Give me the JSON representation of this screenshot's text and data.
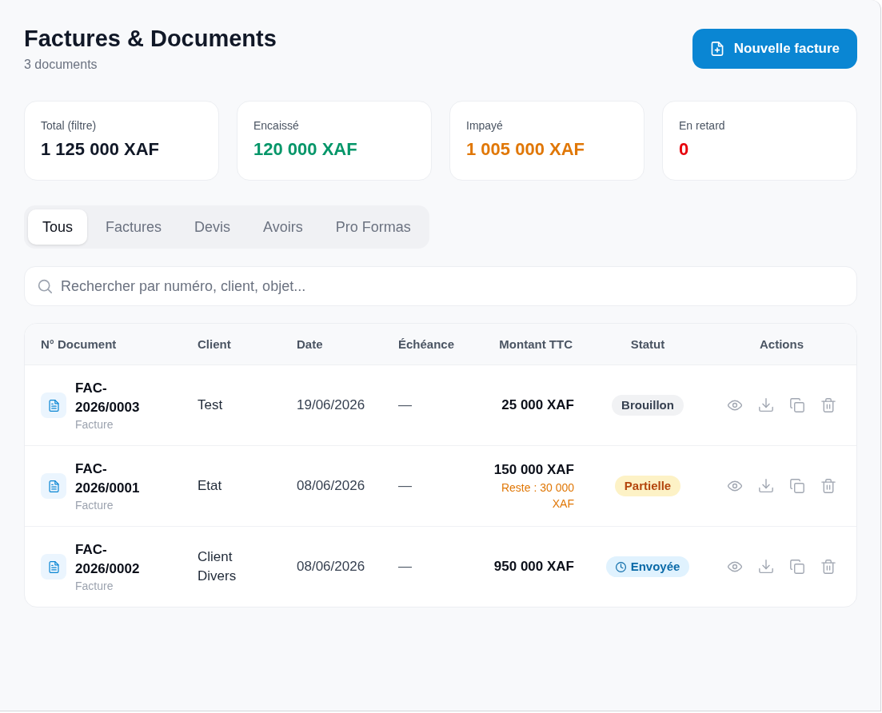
{
  "header": {
    "title": "Factures & Documents",
    "subtitle": "3 documents",
    "new_button": "Nouvelle facture"
  },
  "stats": [
    {
      "label": "Total (filtre)",
      "value": "1 125 000 XAF",
      "color": "#111827"
    },
    {
      "label": "Encaissé",
      "value": "120 000 XAF",
      "color": "#059669"
    },
    {
      "label": "Impayé",
      "value": "1 005 000 XAF",
      "color": "#e07706"
    },
    {
      "label": "En retard",
      "value": "0",
      "color": "#e7000b"
    }
  ],
  "tabs": [
    {
      "label": "Tous",
      "selected": true
    },
    {
      "label": "Factures",
      "selected": false
    },
    {
      "label": "Devis",
      "selected": false
    },
    {
      "label": "Avoirs",
      "selected": false
    },
    {
      "label": "Pro Formas",
      "selected": false
    }
  ],
  "search": {
    "placeholder": "Rechercher par numéro, client, objet..."
  },
  "table": {
    "columns": [
      "N° Document",
      "Client",
      "Date",
      "Échéance",
      "Montant TTC",
      "Statut",
      "Actions"
    ],
    "rows": [
      {
        "number": "FAC-2026/0003",
        "type": "Facture",
        "client": "Test",
        "date": "19/06/2026",
        "due": "—",
        "amount": "25 000 XAF",
        "status": {
          "label": "Brouillon",
          "kind": "draft"
        }
      },
      {
        "number": "FAC-2026/0001",
        "type": "Facture",
        "client": "Etat",
        "date": "08/06/2026",
        "due": "—",
        "amount": "150 000 XAF",
        "remaining": "Reste : 30 000 XAF",
        "status": {
          "label": "Partielle",
          "kind": "partial"
        }
      },
      {
        "number": "FAC-2026/0002",
        "type": "Facture",
        "client": "Client Divers",
        "date": "08/06/2026",
        "due": "—",
        "amount": "950 000 XAF",
        "status": {
          "label": "Envoyée",
          "kind": "sent"
        }
      }
    ]
  }
}
